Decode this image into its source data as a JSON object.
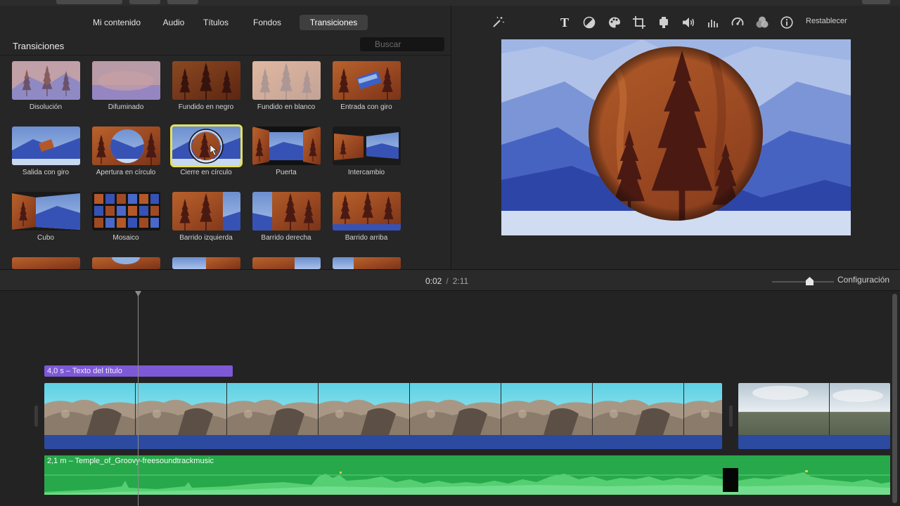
{
  "browser": {
    "tabs": [
      {
        "label": "Mi contenido",
        "active": false
      },
      {
        "label": "Audio",
        "active": false
      },
      {
        "label": "Títulos",
        "active": false
      },
      {
        "label": "Fondos",
        "active": false
      },
      {
        "label": "Transiciones",
        "active": true
      }
    ],
    "section_title": "Transiciones",
    "search_placeholder": "Buscar",
    "transitions": [
      {
        "label": "Disolución"
      },
      {
        "label": "Difuminado"
      },
      {
        "label": "Fundido en negro"
      },
      {
        "label": "Fundido en blanco"
      },
      {
        "label": "Entrada con giro"
      },
      {
        "label": "Salida con giro"
      },
      {
        "label": "Apertura en círculo"
      },
      {
        "label": "Cierre en círculo",
        "selected": true
      },
      {
        "label": "Puerta"
      },
      {
        "label": "Intercambio"
      },
      {
        "label": "Cubo"
      },
      {
        "label": "Mosaico"
      },
      {
        "label": "Barrido izquierda"
      },
      {
        "label": "Barrido derecha"
      },
      {
        "label": "Barrido arriba"
      }
    ]
  },
  "viewer": {
    "toolbar_icons": [
      "magic-wand-icon",
      "text-icon",
      "color-balance-icon",
      "palette-icon",
      "crop-icon",
      "camera-icon",
      "volume-icon",
      "equalizer-icon",
      "speed-icon",
      "filter-icon",
      "info-icon"
    ],
    "reset_label": "Restablecer"
  },
  "timeline_bar": {
    "current_time": "0:02",
    "separator": "/",
    "total_time": "2:11",
    "settings_label": "Configuración",
    "zoom_level": 0.55
  },
  "timeline": {
    "title_clip_label": "4,0 s – Texto del título",
    "music_clip_label": "2,1 m – Temple_of_Groovy-freesoundtrackmusic"
  },
  "colors": {
    "accent_selected": "#e6e05a",
    "title_clip": "#7e59d6",
    "music_clip": "#27a84a",
    "video_audio": "#2b4aa0"
  }
}
